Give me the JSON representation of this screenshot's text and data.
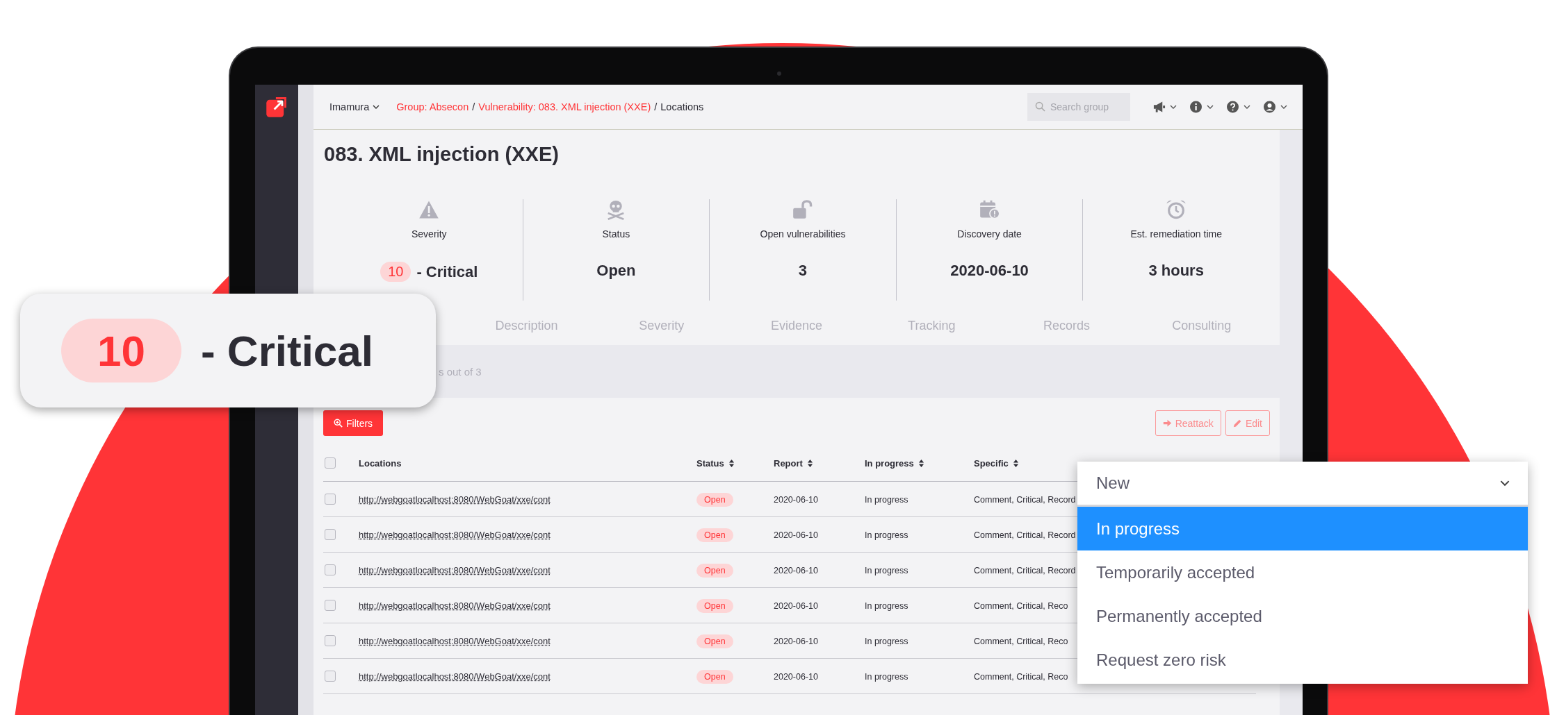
{
  "topbar": {
    "org": "Imamura",
    "breadcrumb": [
      {
        "kind": "link",
        "label": "Group: Absecon"
      },
      {
        "kind": "separator",
        "label": "/"
      },
      {
        "kind": "link",
        "label": "Vulnerability: 083. XML injection (XXE)"
      },
      {
        "kind": "separator",
        "label": "/"
      },
      {
        "kind": "current",
        "label": "Locations"
      }
    ],
    "search": {
      "placeholder": "Search group"
    },
    "menus": [
      {
        "kind": "megaphone"
      },
      {
        "kind": "info"
      },
      {
        "kind": "help"
      },
      {
        "kind": "user"
      }
    ]
  },
  "title": "083. XML injection (XXE)",
  "indicators": [
    {
      "kind": "severity",
      "label": "Severity",
      "score": "10",
      "value": "- Critical"
    },
    {
      "kind": "status",
      "label": "Status",
      "value": "Open"
    },
    {
      "kind": "open",
      "label": "Open vulnerabilities",
      "value": "3"
    },
    {
      "kind": "date",
      "label": "Discovery date",
      "value": "2020-06-10"
    },
    {
      "kind": "time",
      "label": "Est. remediation time",
      "value": "3 hours"
    }
  ],
  "tabs": [
    {
      "label": "Description",
      "selected": false
    },
    {
      "label": "Severity",
      "selected": false
    },
    {
      "label": "Evidence",
      "selected": false
    },
    {
      "label": "Tracking",
      "selected": false
    },
    {
      "label": "Records",
      "selected": false
    },
    {
      "label": "Consulting",
      "selected": false
    }
  ],
  "count_text": "s out of 3",
  "toolbar": {
    "filters": "Filters",
    "reattack": "Reattack",
    "edit": "Edit"
  },
  "table": {
    "header_checked": false,
    "columns": [
      {
        "label": "Locations",
        "sortable": false
      },
      {
        "label": "Status",
        "sortable": true
      },
      {
        "label": "Report",
        "sortable": true
      },
      {
        "label": "In progress",
        "sortable": true
      },
      {
        "label": "Specific",
        "sortable": true
      }
    ],
    "rows": [
      {
        "checked": false,
        "location": "http://webgoatlocalhost:8080/WebGoat/xxe/cont",
        "status": "Open",
        "report": "2020-06-10",
        "in_progress": "In progress",
        "specific": "Comment, Critical, Record"
      },
      {
        "checked": false,
        "location": "http://webgoatlocalhost:8080/WebGoat/xxe/cont",
        "status": "Open",
        "report": "2020-06-10",
        "in_progress": "In progress",
        "specific": "Comment, Critical, Record"
      },
      {
        "checked": false,
        "location": "http://webgoatlocalhost:8080/WebGoat/xxe/cont",
        "status": "Open",
        "report": "2020-06-10",
        "in_progress": "In progress",
        "specific": "Comment, Critical, Record"
      },
      {
        "checked": false,
        "location": "http://webgoatlocalhost:8080/WebGoat/xxe/cont",
        "status": "Open",
        "report": "2020-06-10",
        "in_progress": "In progress",
        "specific": "Comment, Critical, Reco"
      },
      {
        "checked": false,
        "location": "http://webgoatlocalhost:8080/WebGoat/xxe/cont",
        "status": "Open",
        "report": "2020-06-10",
        "in_progress": "In progress",
        "specific": "Comment, Critical, Reco"
      },
      {
        "checked": false,
        "location": "http://webgoatlocalhost:8080/WebGoat/xxe/cont",
        "status": "Open",
        "report": "2020-06-10",
        "in_progress": "In progress",
        "specific": "Comment, Critical, Reco"
      }
    ]
  },
  "dropdown": {
    "value": "New",
    "options": [
      {
        "label": "In progress",
        "selected": true
      },
      {
        "label": "Temporarily accepted",
        "selected": false
      },
      {
        "label": "Permanently accepted",
        "selected": false
      },
      {
        "label": "Request zero risk",
        "selected": false
      }
    ]
  },
  "callout": {
    "score": "10",
    "text": "- Critical"
  }
}
